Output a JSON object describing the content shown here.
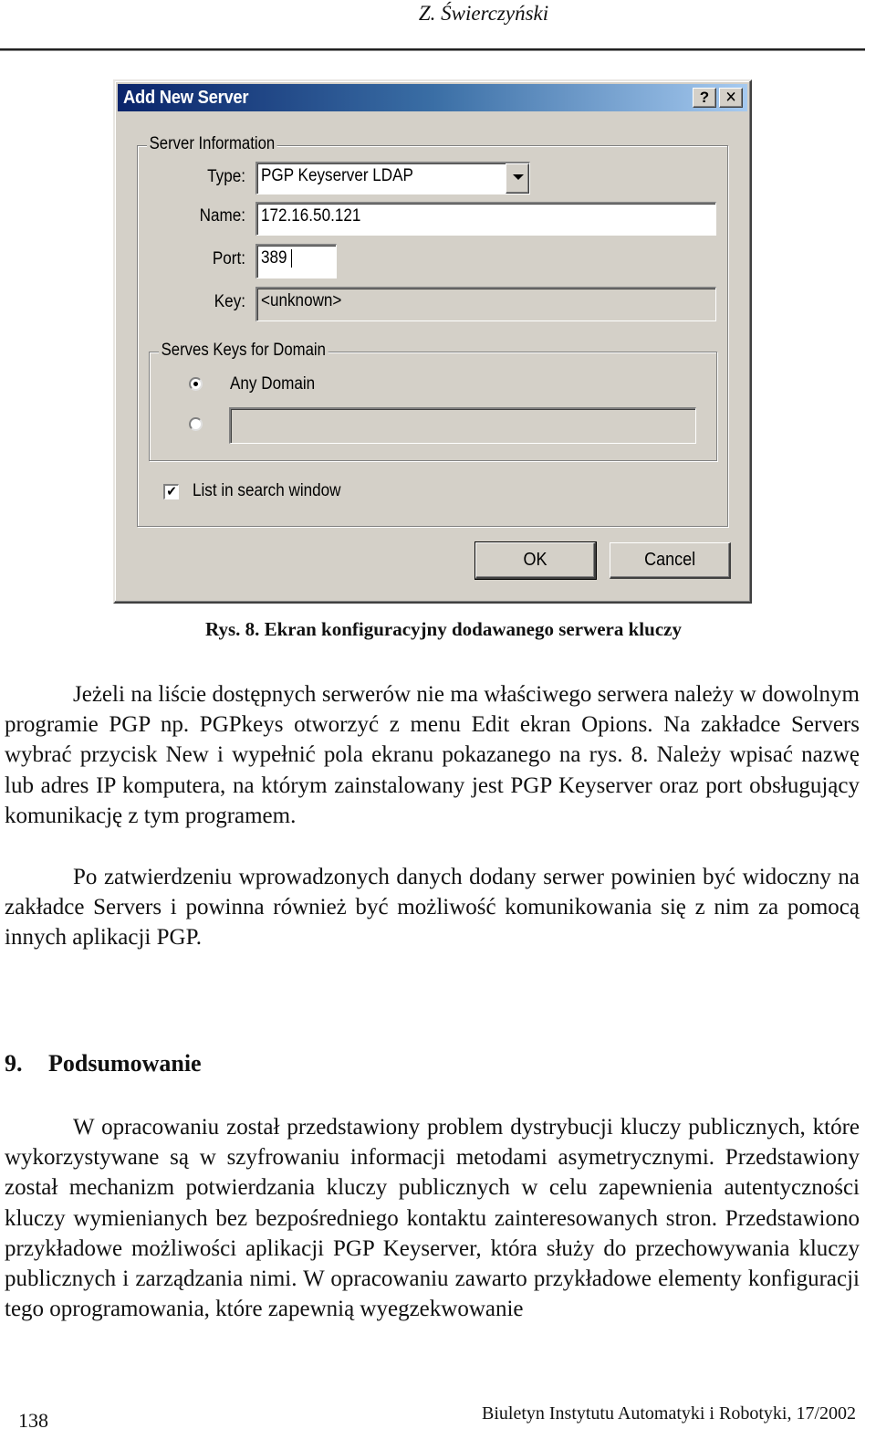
{
  "running_header": {
    "author": "Z. Świerczyński"
  },
  "dialog": {
    "title": "Add New Server",
    "help_button": "?",
    "close_button": "✕",
    "server_information": {
      "group_label": "Server Information",
      "type": {
        "label": "Type:",
        "value": "PGP Keyserver LDAP"
      },
      "name": {
        "label": "Name:",
        "value": "172.16.50.121"
      },
      "port": {
        "label": "Port:",
        "value": "389"
      },
      "key": {
        "label": "Key:",
        "value": "<unknown>"
      }
    },
    "serves_keys_for_domain": {
      "group_label": "Serves Keys for Domain",
      "options": [
        {
          "label": "Any Domain",
          "checked": true
        },
        {
          "label": "",
          "checked": false,
          "domain_value": ""
        }
      ]
    },
    "list_in_search_window": {
      "label": "List in search window",
      "checked": true,
      "mark": "✔"
    },
    "ok_button": "OK",
    "cancel_button": "Cancel"
  },
  "figure_caption": "Rys. 8. Ekran konfiguracyjny dodawanego serwera kluczy",
  "paragraphs": [
    "Jeżeli na liście dostępnych serwerów nie ma właściwego serwera należy w dowolnym programie PGP np. PGPkeys otworzyć z menu Edit ekran Opions. Na zakładce Servers wybrać przycisk New i wypełnić pola ekranu pokazanego na rys. 8. Należy wpisać nazwę lub adres IP komputera, na którym zainstalowany jest PGP Keyserver oraz port obsługujący komunikację z tym programem.",
    "Po zatwierdzeniu wprowadzonych danych dodany serwer powinien być widoczny na zakładce Servers i powinna również być możliwość komunikowania się z nim za pomocą innych aplikacji PGP."
  ],
  "section": {
    "number": "9.",
    "title": "Podsumowanie",
    "paragraph": "W opracowaniu został przedstawiony problem dystrybucji kluczy publicznych, które wykorzystywane są w szyfrowaniu informacji metodami asymetrycznymi. Przedstawiony został mechanizm potwierdzania kluczy publicznych w celu zapewnienia autentyczności kluczy wymienianych bez bezpośredniego kontaktu zainteresowanych stron. Przedstawiono przykładowe możliwości aplikacji PGP Keyserver, która służy do przechowywania kluczy publicznych i zarządzania nimi. W opracowaniu zawarto przykładowe elementy konfiguracji tego oprogramowania, które zapewnią wyegzekwowanie"
  },
  "footer": {
    "page_number": "138",
    "journal": "Biuletyn Instytutu Automatyki i Robotyki, 17/2002"
  }
}
